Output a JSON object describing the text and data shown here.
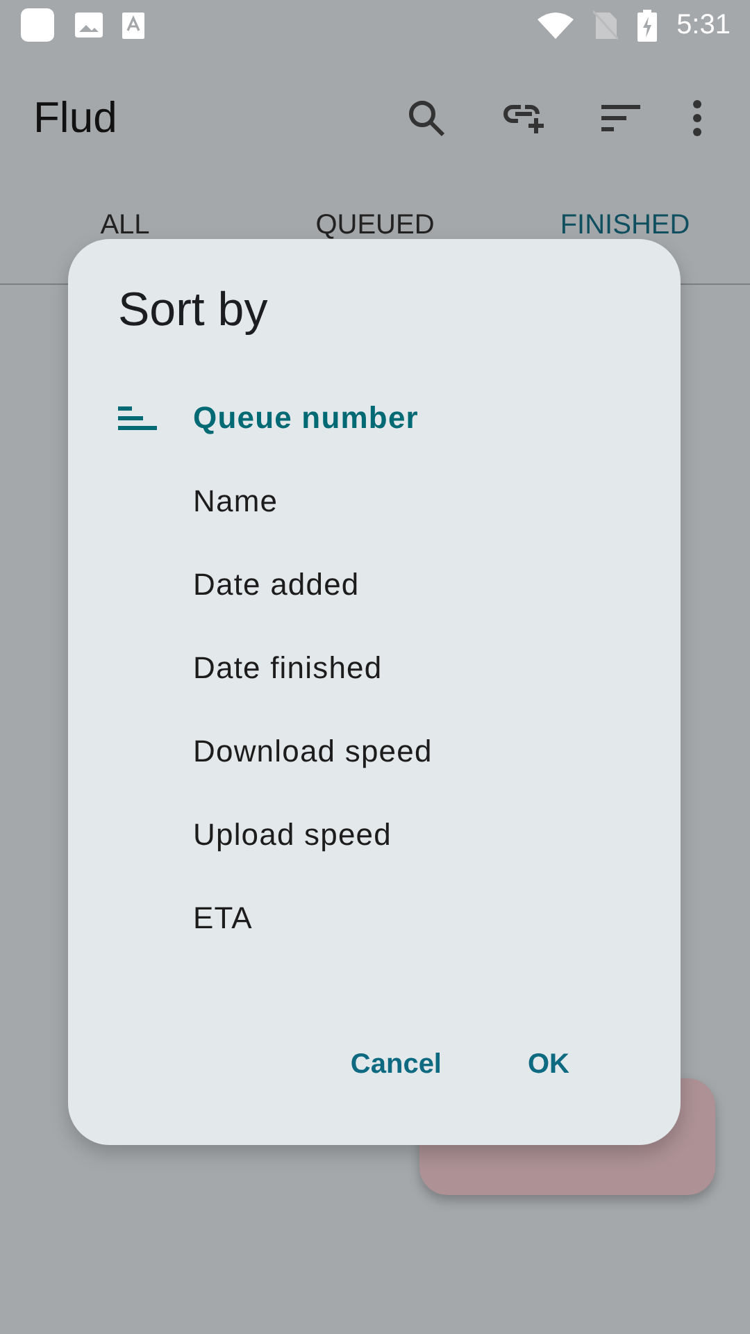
{
  "status_bar": {
    "time": "5:31"
  },
  "app_bar": {
    "title": "Flud"
  },
  "tabs": [
    {
      "label": "ALL",
      "selected": false
    },
    {
      "label": "QUEUED",
      "selected": false
    },
    {
      "label": "FINISHED",
      "selected": true
    }
  ],
  "dialog": {
    "title": "Sort by",
    "options": [
      {
        "label": "Queue number",
        "selected": true
      },
      {
        "label": "Name",
        "selected": false
      },
      {
        "label": "Date added",
        "selected": false
      },
      {
        "label": "Date finished",
        "selected": false
      },
      {
        "label": "Download speed",
        "selected": false
      },
      {
        "label": "Upload speed",
        "selected": false
      },
      {
        "label": "ETA",
        "selected": false
      }
    ],
    "buttons": [
      "Cancel",
      "OK"
    ]
  }
}
